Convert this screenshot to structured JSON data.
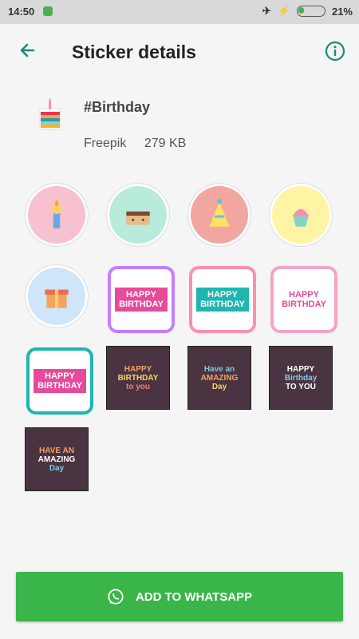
{
  "status": {
    "time": "14:50",
    "battery": "21%",
    "battery_level": 0.21
  },
  "appbar": {
    "title": "Sticker details",
    "back_icon": "arrow-left-icon",
    "info_icon": "info-icon"
  },
  "pack": {
    "name": "#Birthday",
    "publisher": "Freepik",
    "size": "279 KB"
  },
  "stickers": [
    "sticker-1-happy-birthday-candle-pink",
    "sticker-2-to-you-cake-mint",
    "sticker-3-party-hat-salmon",
    "sticker-4-cupcake-yellow",
    "sticker-5-to-you-gift-blue",
    "sticker-6-happy-birthday-gifts-ribbon",
    "sticker-7-happy-birthday-balloons-banner",
    "sticker-8-happy-birthday-cupcakes-badge",
    "sticker-9-happy-birthday-teal-badge",
    "sticker-10-happy-birthday-to-you-dark",
    "sticker-11-have-an-amazing-day-dark",
    "sticker-12-happy-birthday-to-you-balloons-dark",
    "sticker-13-have-an-amazing-day-gift-dark"
  ],
  "cta": {
    "label": "ADD TO WHATSAPP",
    "icon": "whatsapp-icon"
  },
  "colors": {
    "accent": "#1d8a74",
    "button": "#3ab54a"
  }
}
